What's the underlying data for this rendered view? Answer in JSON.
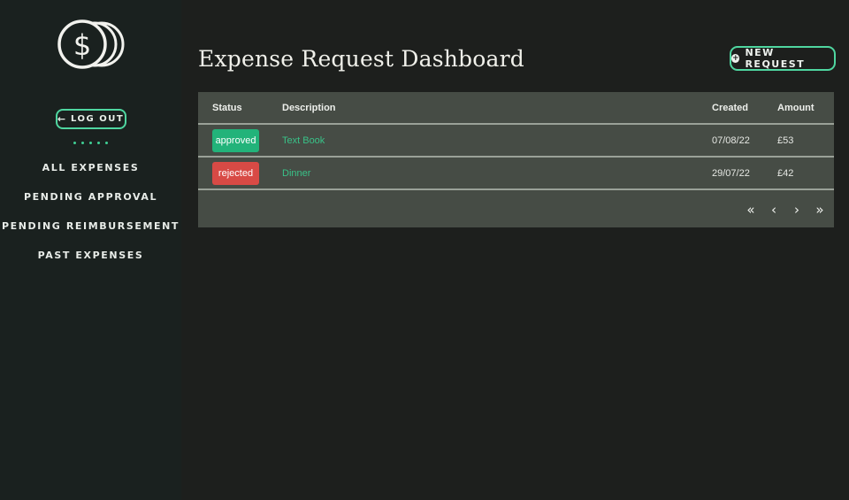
{
  "sidebar": {
    "logout_label": "LOG OUT",
    "nav": [
      {
        "label": "ALL EXPENSES"
      },
      {
        "label": "PENDING APPROVAL"
      },
      {
        "label": "PENDING REIMBURSEMENT"
      },
      {
        "label": "PAST EXPENSES"
      }
    ]
  },
  "header": {
    "title": "Expense Request Dashboard",
    "new_request_label": "NEW REQUEST"
  },
  "table": {
    "columns": [
      "Status",
      "Description",
      "Created",
      "Amount"
    ],
    "rows": [
      {
        "status": "approved",
        "status_color": "#22b37a",
        "description": "Text Book",
        "created": "07/08/22",
        "amount": "£53"
      },
      {
        "status": "rejected",
        "status_color": "#d84a45",
        "description": "Dinner",
        "created": "29/07/22",
        "amount": "£42"
      }
    ]
  },
  "pager": {
    "first": "«",
    "prev": "‹",
    "next": "›",
    "last": "»"
  },
  "colors": {
    "accent": "#4fd6a0",
    "approved": "#22b37a",
    "rejected": "#d84a45"
  },
  "icons": [
    "dollar-coins-icon",
    "arrow-left-icon",
    "plus-circle-icon",
    "chevron-double-left-icon",
    "chevron-left-icon",
    "chevron-right-icon",
    "chevron-double-right-icon"
  ]
}
